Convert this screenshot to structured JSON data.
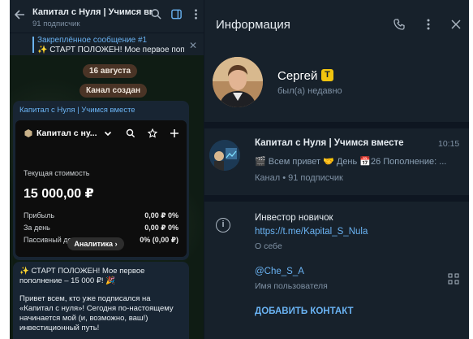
{
  "colors": {
    "accent": "#6ab3f3",
    "panel": "#17212b",
    "badge": "#f1c40f"
  },
  "chat": {
    "title": "Капитал с Нуля | Учимся вмесе",
    "subtitle": "91 подписчик",
    "icons": [
      "back-arrow-icon",
      "search-icon",
      "sidebar-toggle-icon",
      "more-icon"
    ]
  },
  "pinned": {
    "title": "Закреплённое сообщение #1",
    "text": "✨ СТАРТ ПОЛОЖЕН! Мое первое поп"
  },
  "date_pill": "16 августа",
  "created_pill": "Канал создан",
  "card": {
    "header": "Капитал с Нуля | Учимся вместе",
    "account": "Капитал с ну...",
    "current_label": "Текущая стоимость",
    "current_value": "15 000,00 ₽",
    "rows": [
      {
        "label": "Прибыль",
        "value": "0,00 ₽ 0%"
      },
      {
        "label": "За день",
        "value": "0,00 ₽ 0%"
      },
      {
        "label": "Пассивный доход",
        "value": "0% (0,00 ₽)"
      }
    ],
    "analytics": "Аналитика ›"
  },
  "message": {
    "line1": "✨ СТАРТ ПОЛОЖЕН! Мое первое",
    "line2": "пополнение – 15 000 ₽! 🎉",
    "line3": "Привет всем, кто уже подписался на",
    "line4": "«Капитал с нуля»! Сегодня по-настоящему",
    "line5": "начинается мой (и, возможно, ваш!)",
    "line6": "инвестиционный путь!"
  },
  "info": {
    "title": "Информация",
    "name": "Сергей",
    "status": "был(а) недавно",
    "badge": "Т",
    "channel": {
      "title": "Капитал с Нуля | Учимся вместе",
      "time": "10:15",
      "preview": "🎬 Всем привет 🤝 День 📅26  Пополнение: ...",
      "sub": "Канал • 91 подписчик"
    },
    "bio": "Инвестор новичок",
    "link": "https://t.me/Kapital_S_Nula",
    "bio_label": "О себе",
    "username": "@Che_S_A",
    "username_label": "Имя пользователя",
    "add_contact": "ДОБАВИТЬ КОНТАКТ"
  }
}
